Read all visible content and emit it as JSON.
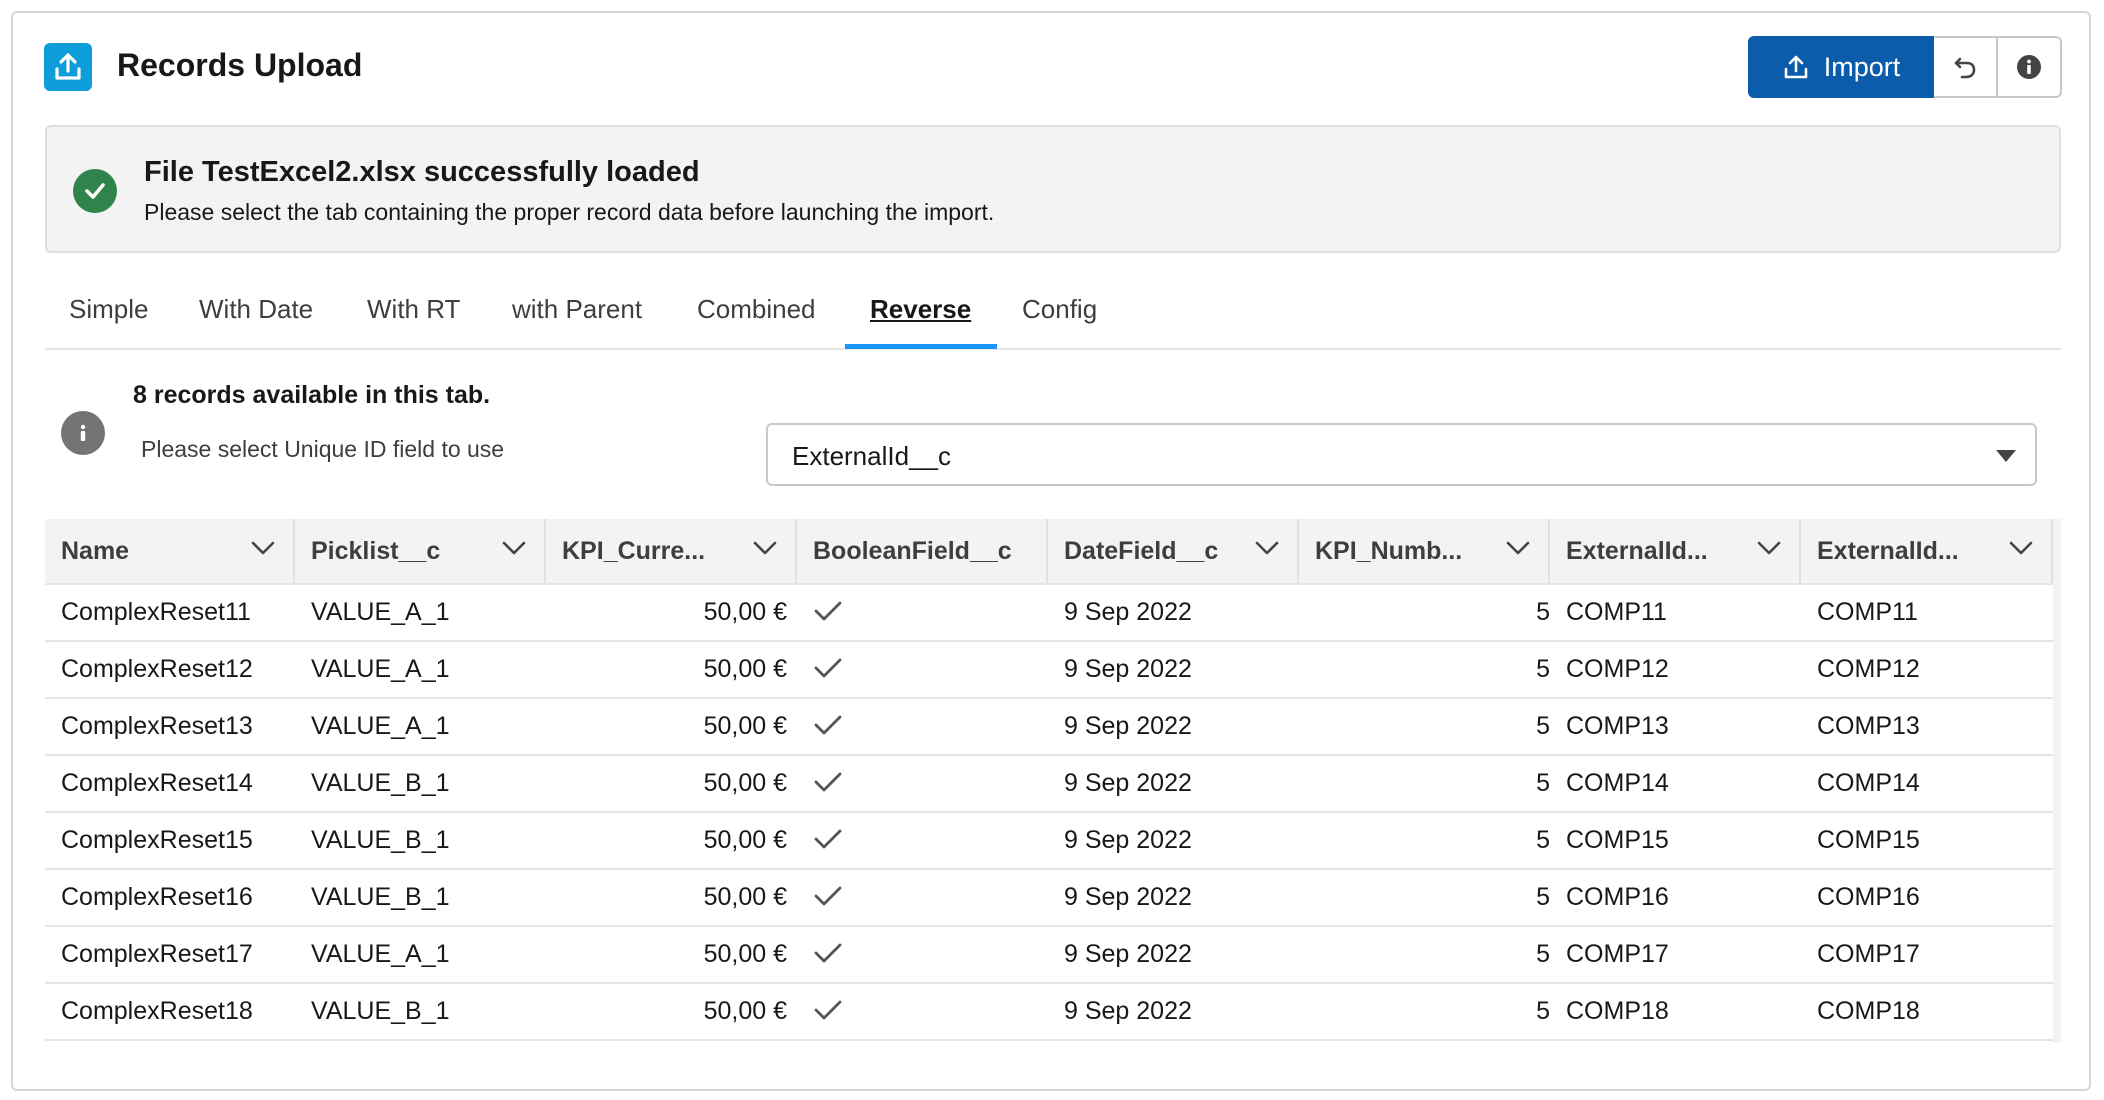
{
  "header": {
    "title": "Records Upload",
    "app_icon": "upload-icon",
    "import_label": "Import",
    "import_icon": "upload-icon",
    "reset_icon": "undo-icon",
    "info_icon": "info-icon"
  },
  "notice": {
    "icon": "success-check-icon",
    "title": "File TestExcel2.xlsx successfully loaded",
    "message": "Please select the tab containing the proper record data before launching the import."
  },
  "tabs": [
    {
      "label": "Simple",
      "active": false
    },
    {
      "label": "With Date",
      "active": false
    },
    {
      "label": "With RT",
      "active": false
    },
    {
      "label": "with Parent",
      "active": false
    },
    {
      "label": "Combined",
      "active": false
    },
    {
      "label": "Reverse",
      "active": true
    },
    {
      "label": "Config",
      "active": false
    }
  ],
  "info": {
    "records_count": "8 records available in this tab.",
    "uid_label": "Please select Unique ID field to use",
    "uid_value": "ExternalId__c"
  },
  "table": {
    "columns": [
      "Name",
      "Picklist__c",
      "KPI_Curre...",
      "BooleanField__c",
      "DateField__c",
      "KPI_Numb...",
      "ExternalId...",
      "ExternalId..."
    ],
    "rows": [
      [
        "ComplexReset11",
        "VALUE_A_1",
        "50,00 €",
        true,
        "9 Sep 2022",
        "5",
        "COMP11",
        "COMP11"
      ],
      [
        "ComplexReset12",
        "VALUE_A_1",
        "50,00 €",
        true,
        "9 Sep 2022",
        "5",
        "COMP12",
        "COMP12"
      ],
      [
        "ComplexReset13",
        "VALUE_A_1",
        "50,00 €",
        true,
        "9 Sep 2022",
        "5",
        "COMP13",
        "COMP13"
      ],
      [
        "ComplexReset14",
        "VALUE_B_1",
        "50,00 €",
        true,
        "9 Sep 2022",
        "5",
        "COMP14",
        "COMP14"
      ],
      [
        "ComplexReset15",
        "VALUE_B_1",
        "50,00 €",
        true,
        "9 Sep 2022",
        "5",
        "COMP15",
        "COMP15"
      ],
      [
        "ComplexReset16",
        "VALUE_B_1",
        "50,00 €",
        true,
        "9 Sep 2022",
        "5",
        "COMP16",
        "COMP16"
      ],
      [
        "ComplexReset17",
        "VALUE_A_1",
        "50,00 €",
        true,
        "9 Sep 2022",
        "5",
        "COMP17",
        "COMP17"
      ],
      [
        "ComplexReset18",
        "VALUE_B_1",
        "50,00 €",
        true,
        "9 Sep 2022",
        "5",
        "COMP18",
        "COMP18"
      ]
    ]
  },
  "colors": {
    "brand_button": "#0b5cab",
    "app_icon_bg": "#0d9dda",
    "success": "#2e844a",
    "active_tab_underline": "#1b96ff"
  }
}
